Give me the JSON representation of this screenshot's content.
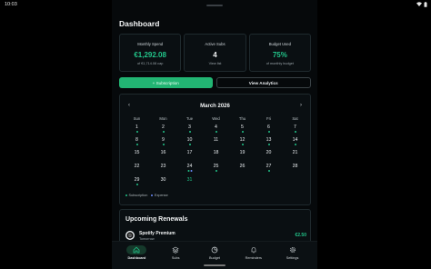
{
  "status_bar": {
    "time": "10:03"
  },
  "app": {
    "title": "Dashboard",
    "stats": [
      {
        "label": "Monthly Spend",
        "value": "€1,292.08",
        "sub": "of €1,714.08 cap",
        "color": "#22c58a"
      },
      {
        "label": "Active Subs",
        "value": "4",
        "sub": "View list",
        "color": "#f2f4f5"
      },
      {
        "label": "Budget Used",
        "value": "75%",
        "sub": "of monthly budget",
        "color": "#22c58a"
      }
    ],
    "buttons": {
      "add_subscription": "+ Subscription",
      "view_analytics": "View Analytics"
    },
    "calendar": {
      "month": "March 2026",
      "prev": "‹",
      "next": "›",
      "weekdays": [
        "Sun",
        "Mon",
        "Tue",
        "Wed",
        "Thu",
        "Fri",
        "Sat"
      ],
      "weeks": [
        [
          {
            "d": "1",
            "dots": [
              "sub"
            ]
          },
          {
            "d": "2",
            "dots": [
              "sub"
            ]
          },
          {
            "d": "3",
            "dots": [
              "sub"
            ]
          },
          {
            "d": "4",
            "dots": [
              "sub"
            ]
          },
          {
            "d": "5",
            "dots": [
              "sub"
            ]
          },
          {
            "d": "6",
            "dots": [
              "sub"
            ]
          },
          {
            "d": "7",
            "dots": [
              "sub"
            ]
          }
        ],
        [
          {
            "d": "8",
            "dots": [
              "sub"
            ]
          },
          {
            "d": "9",
            "dots": [
              "sub"
            ]
          },
          {
            "d": "10",
            "dots": [
              "sub"
            ]
          },
          {
            "d": "11",
            "dots": []
          },
          {
            "d": "12",
            "dots": [
              "sub"
            ]
          },
          {
            "d": "13",
            "dots": [
              "sub"
            ]
          },
          {
            "d": "14",
            "dots": [
              "sub"
            ]
          }
        ],
        [
          {
            "d": "15",
            "dots": []
          },
          {
            "d": "16",
            "dots": []
          },
          {
            "d": "17",
            "dots": []
          },
          {
            "d": "18",
            "dots": []
          },
          {
            "d": "19",
            "dots": []
          },
          {
            "d": "20",
            "dots": []
          },
          {
            "d": "21",
            "dots": []
          }
        ],
        [
          {
            "d": "22",
            "dots": []
          },
          {
            "d": "23",
            "dots": []
          },
          {
            "d": "24",
            "dots": [
              "sub",
              "exp"
            ]
          },
          {
            "d": "25",
            "dots": [
              "sub"
            ]
          },
          {
            "d": "26",
            "dots": []
          },
          {
            "d": "27",
            "dots": [
              "sub"
            ]
          },
          {
            "d": "28",
            "dots": []
          }
        ],
        [
          {
            "d": "29",
            "dots": [
              "sub"
            ]
          },
          {
            "d": "30",
            "dots": []
          },
          {
            "d": "31",
            "dots": [],
            "accent": true
          },
          {
            "d": "",
            "dots": []
          },
          {
            "d": "",
            "dots": []
          },
          {
            "d": "",
            "dots": []
          },
          {
            "d": "",
            "dots": []
          }
        ]
      ],
      "legend": {
        "subscription": "Subscription",
        "expense": "Expense"
      }
    },
    "renewals": {
      "title": "Upcoming Renewals",
      "items": [
        {
          "name": "Spotify Premium",
          "when": "Tomorrow",
          "amount": "€2.50"
        }
      ]
    },
    "nav": [
      {
        "label": "Dashboard",
        "icon": "home-icon",
        "active": true
      },
      {
        "label": "Subs",
        "icon": "layers-icon",
        "active": false
      },
      {
        "label": "Budget",
        "icon": "pie-chart-icon",
        "active": false
      },
      {
        "label": "Reminders",
        "icon": "bell-icon",
        "active": false
      },
      {
        "label": "Settings",
        "icon": "gear-icon",
        "active": false
      }
    ]
  }
}
